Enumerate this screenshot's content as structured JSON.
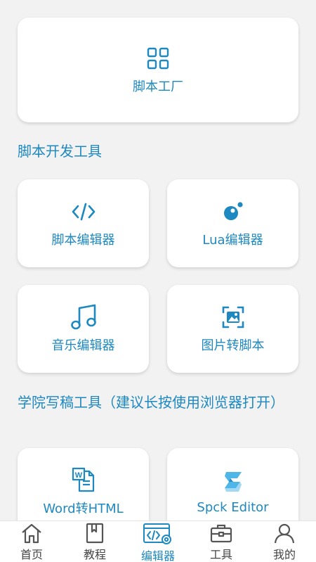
{
  "top_card": {
    "label": "脚本工厂",
    "icon": "grid-icon"
  },
  "sections": [
    {
      "title": "脚本开发工具",
      "cards": [
        {
          "label": "脚本编辑器",
          "icon": "code-brackets-icon"
        },
        {
          "label": "Lua编辑器",
          "icon": "lua-icon"
        },
        {
          "label": "音乐编辑器",
          "icon": "music-note-icon"
        },
        {
          "label": "图片转脚本",
          "icon": "image-scan-icon"
        }
      ]
    },
    {
      "title": "学院写稿工具（建议长按使用浏览器打开）",
      "cards": [
        {
          "label": "Word转HTML",
          "icon": "word-doc-icon"
        },
        {
          "label": "Spck Editor",
          "icon": "spck-logo-icon"
        }
      ]
    }
  ],
  "tabbar": {
    "active": "编辑器",
    "tabs": [
      {
        "label": "首页",
        "icon": "home-icon"
      },
      {
        "label": "教程",
        "icon": "book-icon"
      },
      {
        "label": "编辑器",
        "icon": "editor-settings-icon"
      },
      {
        "label": "工具",
        "icon": "toolbox-icon"
      },
      {
        "label": "我的",
        "icon": "user-icon"
      }
    ]
  },
  "colors": {
    "accent": "#1e88c0",
    "background": "#f2f2f2",
    "card": "#ffffff"
  }
}
